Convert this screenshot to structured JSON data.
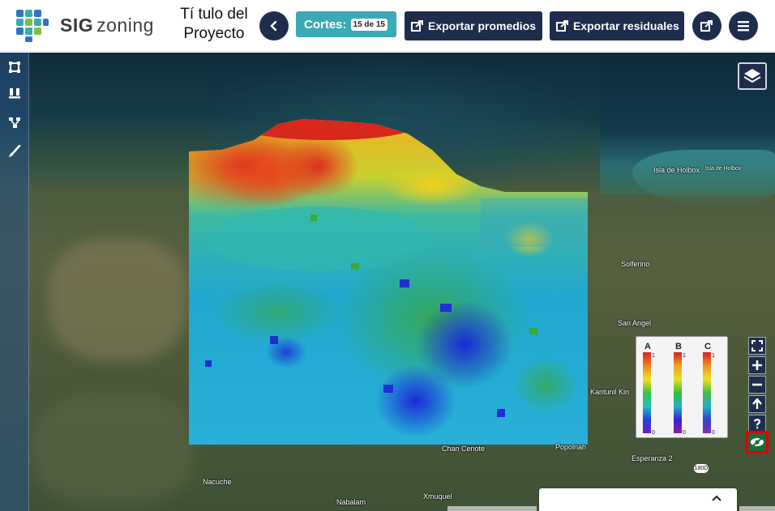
{
  "header": {
    "brand_bold": "SIG",
    "brand_light": "zoning",
    "project_title": "Tí tulo del Proyecto",
    "cortes_label": "Cortes:",
    "cortes_badge": "15 de 15",
    "export_averages_label": "Exportar promedios",
    "export_residuals_label": "Exportar residuales"
  },
  "icons": {
    "back": "chevron-left-icon",
    "export": "external-link-icon",
    "share": "share-icon",
    "menu": "hamburger-menu-icon",
    "layers": "layers-icon",
    "tools": [
      "select-area-icon",
      "compare-icon",
      "network-icon",
      "brush-icon"
    ],
    "map_controls": [
      "fullscreen-icon",
      "zoom-in-icon",
      "zoom-out-icon",
      "north-arrow-icon",
      "help-icon"
    ],
    "visibility": "eye-slash-icon"
  },
  "legend": {
    "columns": [
      {
        "letter": "A",
        "max": "1",
        "min": "0"
      },
      {
        "letter": "B",
        "max": "1",
        "min": "0"
      },
      {
        "letter": "C",
        "max": "1",
        "min": "0"
      }
    ]
  },
  "map_labels": {
    "isla_holbox": "Isla de Holbox",
    "isla_holbox_small": "Isla de Holbox",
    "solferino": "Solferino",
    "san_angel": "San Angel",
    "kantunil_kin": "Kantunil Kin",
    "chan_cenote": "Chan Cenote",
    "popolnah": "Popolnah",
    "esperanza": "Esperanza 2",
    "nacuche": "Nacuche",
    "nabalam": "Nabalam",
    "xmuquel": "Xmuquel",
    "highway": "180D"
  },
  "colors": {
    "navy": "#1e2d4c",
    "teal": "#3aaab5",
    "highlight": "#e00000"
  }
}
